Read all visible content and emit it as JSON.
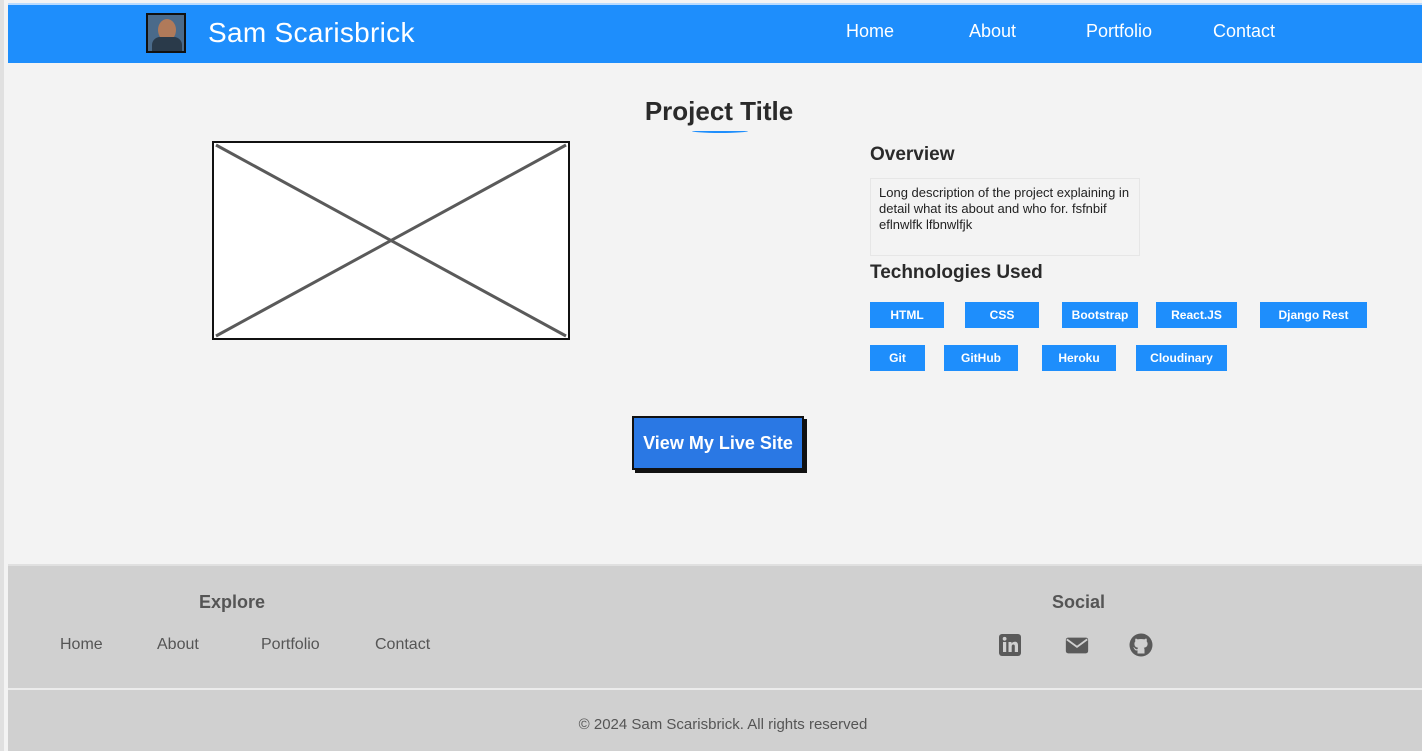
{
  "header": {
    "brand": "Sam Scarisbrick",
    "nav": {
      "home": "Home",
      "about": "About",
      "portfolio": "Portfolio",
      "contact": "Contact"
    }
  },
  "main": {
    "title": "Project Title",
    "overview_heading": "Overview",
    "overview_text": "Long description of the project explaining in detail what its about and who for. fsfnbif eflnwlfk lfbnwlfjk",
    "tech_heading": "Technologies Used",
    "technologies": [
      "HTML",
      "CSS",
      "Bootstrap",
      "React.JS",
      "Django Rest",
      "Git",
      "GitHub",
      "Heroku",
      "Cloudinary"
    ],
    "live_button": "View My Live Site"
  },
  "footer": {
    "explore_heading": "Explore",
    "links": {
      "home": "Home",
      "about": "About",
      "portfolio": "Portfolio",
      "contact": "Contact"
    },
    "social_heading": "Social",
    "social_icons": [
      "linkedin-icon",
      "envelope-icon",
      "github-icon"
    ],
    "copyright": "© 2024 Sam Scarisbrick. All rights reserved"
  },
  "colors": {
    "accent": "#1e8efc",
    "button": "#2a78e4",
    "footer_bg": "#d0d0d0",
    "page_bg": "#f3f3f3"
  }
}
